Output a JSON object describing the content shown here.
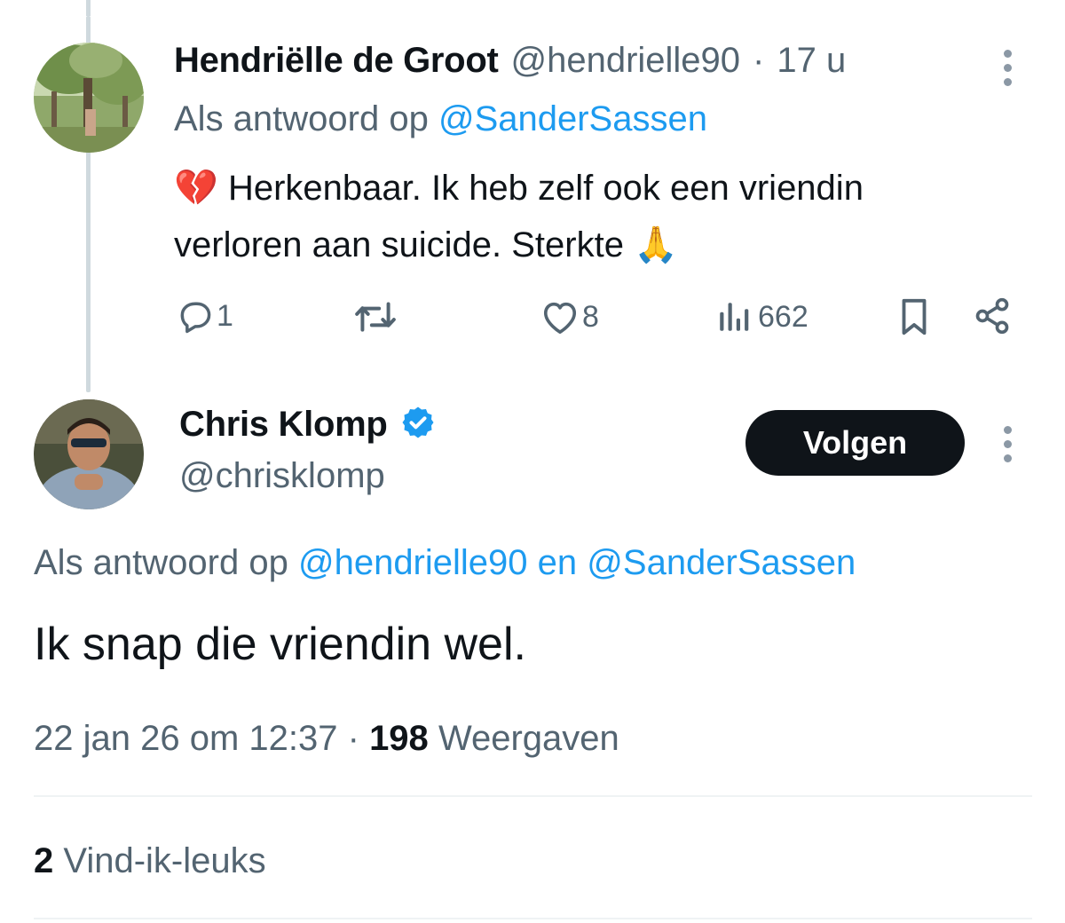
{
  "parent_tweet": {
    "display_name": "Hendriëlle de Groot",
    "handle": "@hendrielle90",
    "separator": "·",
    "time": "17 u",
    "reply_prefix": "Als antwoord op",
    "reply_mention": "@SanderSassen",
    "emoji_start": "💔",
    "text_line1": "Herkenbaar. Ik heb zelf ook een vriendin",
    "text_line2": "verloren aan suicide. Sterkte",
    "emoji_end": "🙏",
    "actions": {
      "replies": "1",
      "reposts": "",
      "likes": "8",
      "views": "662"
    }
  },
  "main_tweet": {
    "display_name": "Chris Klomp",
    "handle": "@chrisklomp",
    "follow_label": "Volgen",
    "reply_prefix": "Als antwoord op",
    "reply_mention_1": "@hendrielle90",
    "reply_and": "en",
    "reply_mention_2": "@SanderSassen",
    "text": "Ik snap die vriendin wel.",
    "timestamp": "22 jan 26 om 12:37",
    "separator": "·",
    "views_count": "198",
    "views_label": "Weergaven",
    "likes_count": "2",
    "likes_label": "Vind-ik-leuks"
  },
  "colors": {
    "link": "#1d9bf0",
    "muted": "#536471",
    "verified": "#1d9bf0",
    "follow_button": "#0f1419"
  },
  "icons": [
    "reply-icon",
    "repost-icon",
    "like-icon",
    "views-icon",
    "bookmark-icon",
    "share-icon",
    "more-icon",
    "verified-badge-icon"
  ]
}
